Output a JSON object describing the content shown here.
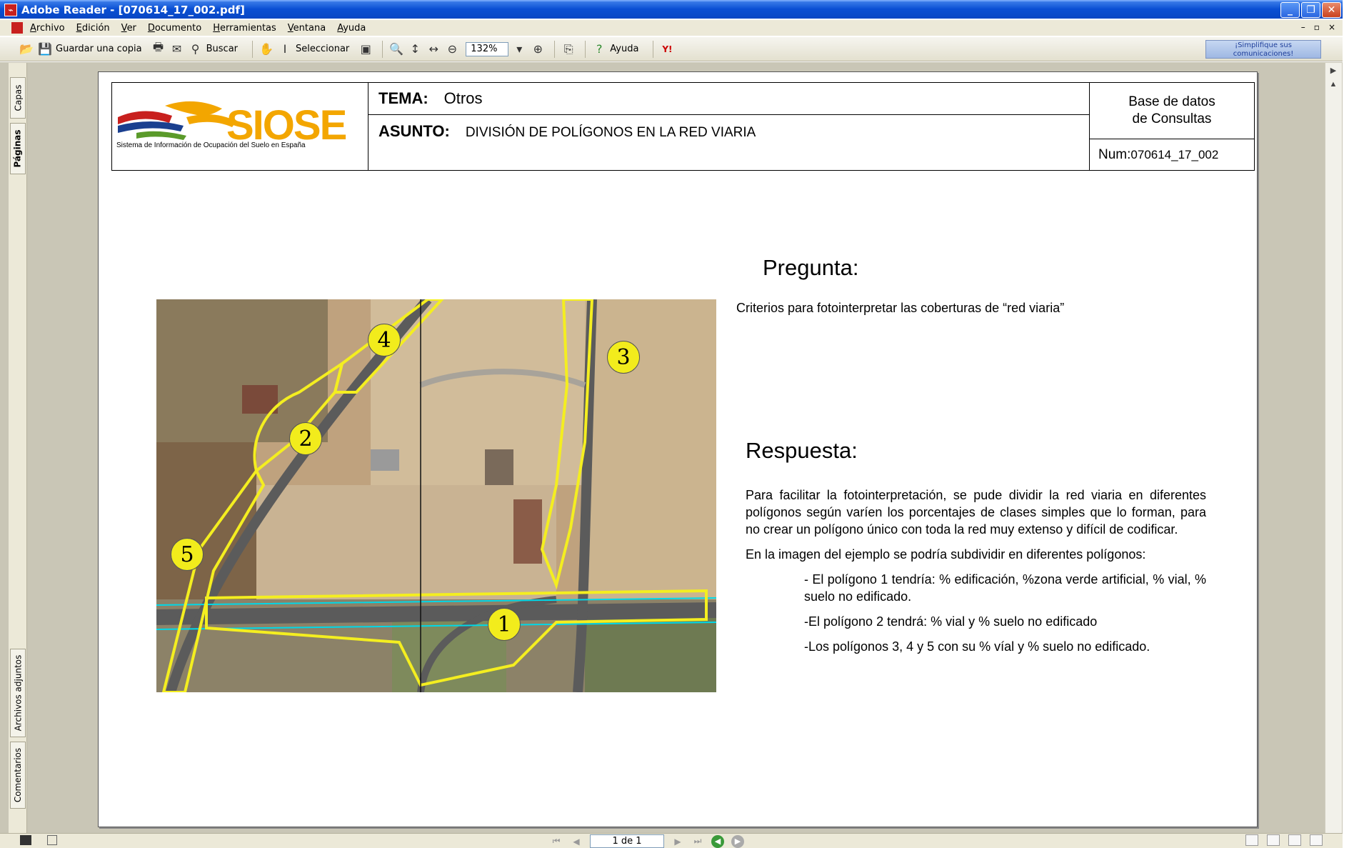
{
  "window": {
    "title": "Adobe Reader - [070614_17_002.pdf]",
    "app_icon": "adobe-reader-icon",
    "controls": [
      "minimize",
      "restore",
      "close"
    ]
  },
  "menubar": {
    "items": [
      "Archivo",
      "Edición",
      "Ver",
      "Documento",
      "Herramientas",
      "Ventana",
      "Ayuda"
    ],
    "right_controls": [
      "–",
      "▫",
      "×"
    ]
  },
  "toolbar": {
    "save_copy": "Guardar una copia",
    "search": "Buscar",
    "select": "Seleccionar",
    "zoom_value": "132%",
    "help": "Ayuda",
    "promo": "¡Simplifique sus comunicaciones!"
  },
  "side_tabs": {
    "layers": "Capas",
    "pages": "Páginas",
    "attachments": "Archivos adjuntos",
    "comments": "Comentarios"
  },
  "document": {
    "header": {
      "logo_word": "SIOSE",
      "logo_subtitle": "Sistema de Información de Ocupación del Suelo en España",
      "tema_label": "TEMA:",
      "tema_value": "Otros",
      "asunto_label": "ASUNTO:",
      "asunto_value": "DIVISIÓN DE POLÍGONOS EN LA RED VIARIA",
      "db_line1": "Base de datos",
      "db_line2": "de Consultas",
      "num_label": "Num:",
      "num_value": "070614_17_002"
    },
    "pregunta": {
      "title": "Pregunta:",
      "text": "Criterios para  fotointerpretar las coberturas de “red viaria”"
    },
    "respuesta": {
      "title": "Respuesta:",
      "p1": "Para facilitar la fotointerpretación, se pude dividir la red viaria en diferentes polígonos según varíen los porcentajes de clases simples que lo forman, para no crear un polígono único con toda la red muy extenso y difícil de codificar.",
      "p2": "En la imagen del ejemplo se podría subdividir en diferentes polígonos:",
      "p3": "- El polígono 1 tendría: % edificación, %zona verde artificial, % vial, % suelo no edificado.",
      "p4": "-El polígono 2 tendrá: % vial y % suelo no edificado",
      "p5": "-Los polígonos 3, 4 y 5 con su % víal y % suelo no edificado."
    },
    "image_labels": [
      "1",
      "2",
      "3",
      "4",
      "5"
    ]
  },
  "statusbar": {
    "page_indicator": "1 de 1"
  }
}
